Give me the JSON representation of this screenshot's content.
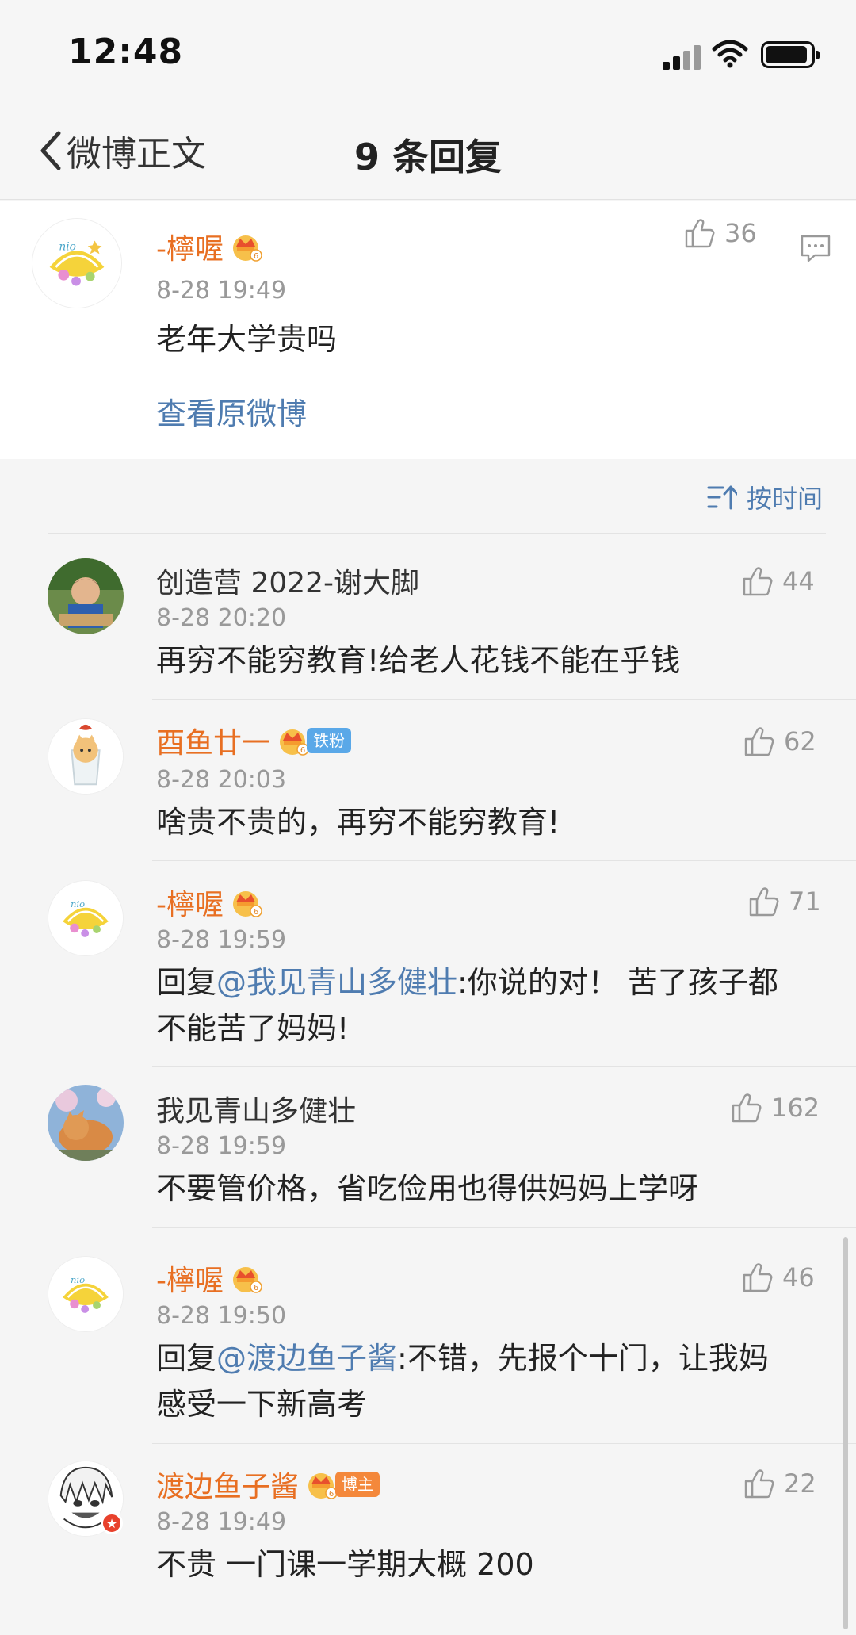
{
  "status_bar": {
    "time": "12:48"
  },
  "nav": {
    "back_label": "微博正文",
    "title": "9 条回复"
  },
  "main_comment": {
    "username": "-檸喔",
    "time": "8-28 19:49",
    "text": "老年大学贵吗",
    "likes": "36",
    "view_original": "查看原微博"
  },
  "sort": {
    "label": "按时间"
  },
  "replies": [
    {
      "username": "创造营 2022-谢大脚",
      "time": "8-28 20:20",
      "text": "再穷不能穷教育!给老人花钱不能在乎钱",
      "likes": "44"
    },
    {
      "username": "酉鱼廿一",
      "badge": "铁粉",
      "time": "8-28 20:03",
      "text": "啥贵不贵的，再穷不能穷教育!",
      "likes": "62"
    },
    {
      "username": "-檸喔",
      "time": "8-28 19:59",
      "prefix": "回复",
      "mention": "@我见青山多健壮",
      "text_line1": ":你说的对！ 苦了孩子都",
      "text_line2": "不能苦了妈妈!",
      "likes": "71"
    },
    {
      "username": "我见青山多健壮",
      "time": "8-28 19:59",
      "text": "不要管价格，省吃俭用也得供妈妈上学呀",
      "likes": "162"
    },
    {
      "username": "-檸喔",
      "time": "8-28 19:50",
      "prefix": "回复",
      "mention": "@渡边鱼子酱",
      "text_line1": ":不错，先报个十门，让我妈",
      "text_line2": "感受一下新高考",
      "likes": "46"
    },
    {
      "username": "渡边鱼子酱",
      "badge": "博主",
      "time": "8-28 19:49",
      "text": "不贵 一门课一学期大概 200",
      "likes": "22"
    }
  ],
  "colors": {
    "username_orange": "#e86f22",
    "link_blue": "#4f7cb0",
    "muted_gray": "#999999"
  },
  "icons": [
    "chevron-left-icon",
    "thumb-up-icon",
    "reply-bubble-icon",
    "sort-time-icon",
    "crown-icon",
    "signal-icon",
    "wifi-icon",
    "battery-icon"
  ]
}
